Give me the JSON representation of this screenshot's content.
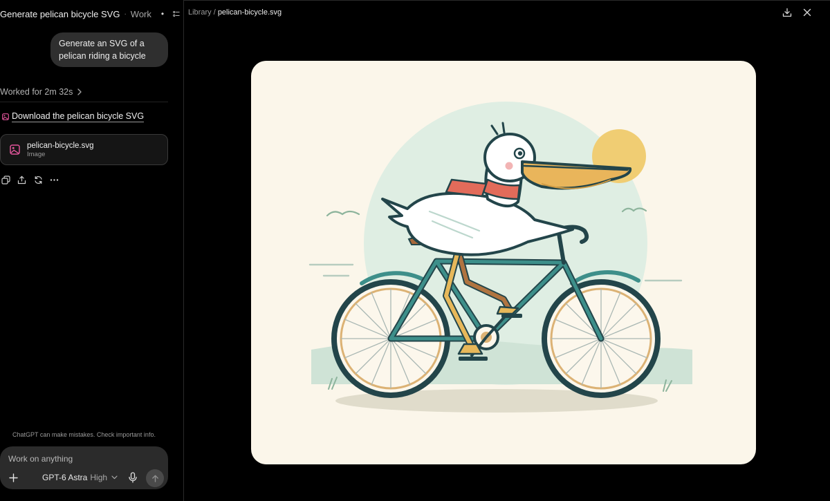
{
  "chat": {
    "title": "Generate pelican bicycle SVG",
    "project": "Work",
    "user_message": "Generate an SVG of a pelican riding a bicycle",
    "worked_label": "Worked for 2m 32s",
    "download_link_text": "Download the pelican bicycle SVG",
    "file": {
      "name": "pelican-bicycle.svg",
      "type": "Image"
    },
    "disclaimer": "ChatGPT can make mistakes. Check important info."
  },
  "composer": {
    "placeholder": "Work on anything",
    "model": "GPT-6 Astra",
    "effort": "High"
  },
  "preview": {
    "breadcrumb_root": "Library",
    "breadcrumb_sep": "/",
    "breadcrumb_file": "pelican-bicycle.svg"
  },
  "icons": {
    "tasks": "tasks-icon",
    "chevron": "chevron-right-icon",
    "image": "image-icon",
    "copy": "copy-icon",
    "share": "share-icon",
    "regenerate": "refresh-icon",
    "more": "more-icon",
    "plus": "plus-icon",
    "mic": "mic-icon",
    "send": "arrow-up-icon",
    "download": "download-icon",
    "close": "close-icon"
  },
  "colors": {
    "background": "#000000",
    "bubble": "#2f2f2f",
    "composer": "#2b2b2b",
    "canvas": "#fbf6ea",
    "accent_pink": "#e0559a",
    "bike_frame": "#3d8f8a",
    "sun": "#f0cd73"
  }
}
